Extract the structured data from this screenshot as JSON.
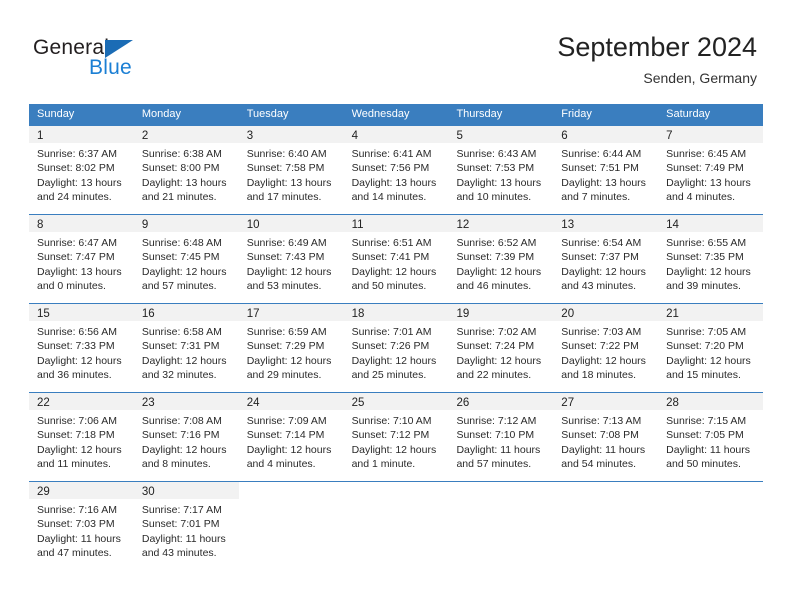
{
  "brand": {
    "name_primary": "General",
    "name_secondary": "Blue",
    "triangle_color": "#1b6cb5",
    "secondary_color": "#1b7fd4"
  },
  "header": {
    "title": "September 2024",
    "subtitle": "Senden, Germany"
  },
  "theme": {
    "header_bg": "#3a7ebf",
    "daynum_band": "#f2f2f2",
    "row_border": "#3a7ebf"
  },
  "weekdays": [
    "Sunday",
    "Monday",
    "Tuesday",
    "Wednesday",
    "Thursday",
    "Friday",
    "Saturday"
  ],
  "labels": {
    "sunrise_prefix": "Sunrise:",
    "sunset_prefix": "Sunset:",
    "daylight_prefix": "Daylight:"
  },
  "weeks": [
    [
      {
        "day": "1",
        "sunrise": "Sunrise: 6:37 AM",
        "sunset": "Sunset: 8:02 PM",
        "daylight_line1": "Daylight: 13 hours",
        "daylight_line2": "and 24 minutes."
      },
      {
        "day": "2",
        "sunrise": "Sunrise: 6:38 AM",
        "sunset": "Sunset: 8:00 PM",
        "daylight_line1": "Daylight: 13 hours",
        "daylight_line2": "and 21 minutes."
      },
      {
        "day": "3",
        "sunrise": "Sunrise: 6:40 AM",
        "sunset": "Sunset: 7:58 PM",
        "daylight_line1": "Daylight: 13 hours",
        "daylight_line2": "and 17 minutes."
      },
      {
        "day": "4",
        "sunrise": "Sunrise: 6:41 AM",
        "sunset": "Sunset: 7:56 PM",
        "daylight_line1": "Daylight: 13 hours",
        "daylight_line2": "and 14 minutes."
      },
      {
        "day": "5",
        "sunrise": "Sunrise: 6:43 AM",
        "sunset": "Sunset: 7:53 PM",
        "daylight_line1": "Daylight: 13 hours",
        "daylight_line2": "and 10 minutes."
      },
      {
        "day": "6",
        "sunrise": "Sunrise: 6:44 AM",
        "sunset": "Sunset: 7:51 PM",
        "daylight_line1": "Daylight: 13 hours",
        "daylight_line2": "and 7 minutes."
      },
      {
        "day": "7",
        "sunrise": "Sunrise: 6:45 AM",
        "sunset": "Sunset: 7:49 PM",
        "daylight_line1": "Daylight: 13 hours",
        "daylight_line2": "and 4 minutes."
      }
    ],
    [
      {
        "day": "8",
        "sunrise": "Sunrise: 6:47 AM",
        "sunset": "Sunset: 7:47 PM",
        "daylight_line1": "Daylight: 13 hours",
        "daylight_line2": "and 0 minutes."
      },
      {
        "day": "9",
        "sunrise": "Sunrise: 6:48 AM",
        "sunset": "Sunset: 7:45 PM",
        "daylight_line1": "Daylight: 12 hours",
        "daylight_line2": "and 57 minutes."
      },
      {
        "day": "10",
        "sunrise": "Sunrise: 6:49 AM",
        "sunset": "Sunset: 7:43 PM",
        "daylight_line1": "Daylight: 12 hours",
        "daylight_line2": "and 53 minutes."
      },
      {
        "day": "11",
        "sunrise": "Sunrise: 6:51 AM",
        "sunset": "Sunset: 7:41 PM",
        "daylight_line1": "Daylight: 12 hours",
        "daylight_line2": "and 50 minutes."
      },
      {
        "day": "12",
        "sunrise": "Sunrise: 6:52 AM",
        "sunset": "Sunset: 7:39 PM",
        "daylight_line1": "Daylight: 12 hours",
        "daylight_line2": "and 46 minutes."
      },
      {
        "day": "13",
        "sunrise": "Sunrise: 6:54 AM",
        "sunset": "Sunset: 7:37 PM",
        "daylight_line1": "Daylight: 12 hours",
        "daylight_line2": "and 43 minutes."
      },
      {
        "day": "14",
        "sunrise": "Sunrise: 6:55 AM",
        "sunset": "Sunset: 7:35 PM",
        "daylight_line1": "Daylight: 12 hours",
        "daylight_line2": "and 39 minutes."
      }
    ],
    [
      {
        "day": "15",
        "sunrise": "Sunrise: 6:56 AM",
        "sunset": "Sunset: 7:33 PM",
        "daylight_line1": "Daylight: 12 hours",
        "daylight_line2": "and 36 minutes."
      },
      {
        "day": "16",
        "sunrise": "Sunrise: 6:58 AM",
        "sunset": "Sunset: 7:31 PM",
        "daylight_line1": "Daylight: 12 hours",
        "daylight_line2": "and 32 minutes."
      },
      {
        "day": "17",
        "sunrise": "Sunrise: 6:59 AM",
        "sunset": "Sunset: 7:29 PM",
        "daylight_line1": "Daylight: 12 hours",
        "daylight_line2": "and 29 minutes."
      },
      {
        "day": "18",
        "sunrise": "Sunrise: 7:01 AM",
        "sunset": "Sunset: 7:26 PM",
        "daylight_line1": "Daylight: 12 hours",
        "daylight_line2": "and 25 minutes."
      },
      {
        "day": "19",
        "sunrise": "Sunrise: 7:02 AM",
        "sunset": "Sunset: 7:24 PM",
        "daylight_line1": "Daylight: 12 hours",
        "daylight_line2": "and 22 minutes."
      },
      {
        "day": "20",
        "sunrise": "Sunrise: 7:03 AM",
        "sunset": "Sunset: 7:22 PM",
        "daylight_line1": "Daylight: 12 hours",
        "daylight_line2": "and 18 minutes."
      },
      {
        "day": "21",
        "sunrise": "Sunrise: 7:05 AM",
        "sunset": "Sunset: 7:20 PM",
        "daylight_line1": "Daylight: 12 hours",
        "daylight_line2": "and 15 minutes."
      }
    ],
    [
      {
        "day": "22",
        "sunrise": "Sunrise: 7:06 AM",
        "sunset": "Sunset: 7:18 PM",
        "daylight_line1": "Daylight: 12 hours",
        "daylight_line2": "and 11 minutes."
      },
      {
        "day": "23",
        "sunrise": "Sunrise: 7:08 AM",
        "sunset": "Sunset: 7:16 PM",
        "daylight_line1": "Daylight: 12 hours",
        "daylight_line2": "and 8 minutes."
      },
      {
        "day": "24",
        "sunrise": "Sunrise: 7:09 AM",
        "sunset": "Sunset: 7:14 PM",
        "daylight_line1": "Daylight: 12 hours",
        "daylight_line2": "and 4 minutes."
      },
      {
        "day": "25",
        "sunrise": "Sunrise: 7:10 AM",
        "sunset": "Sunset: 7:12 PM",
        "daylight_line1": "Daylight: 12 hours",
        "daylight_line2": "and 1 minute."
      },
      {
        "day": "26",
        "sunrise": "Sunrise: 7:12 AM",
        "sunset": "Sunset: 7:10 PM",
        "daylight_line1": "Daylight: 11 hours",
        "daylight_line2": "and 57 minutes."
      },
      {
        "day": "27",
        "sunrise": "Sunrise: 7:13 AM",
        "sunset": "Sunset: 7:08 PM",
        "daylight_line1": "Daylight: 11 hours",
        "daylight_line2": "and 54 minutes."
      },
      {
        "day": "28",
        "sunrise": "Sunrise: 7:15 AM",
        "sunset": "Sunset: 7:05 PM",
        "daylight_line1": "Daylight: 11 hours",
        "daylight_line2": "and 50 minutes."
      }
    ],
    [
      {
        "day": "29",
        "sunrise": "Sunrise: 7:16 AM",
        "sunset": "Sunset: 7:03 PM",
        "daylight_line1": "Daylight: 11 hours",
        "daylight_line2": "and 47 minutes."
      },
      {
        "day": "30",
        "sunrise": "Sunrise: 7:17 AM",
        "sunset": "Sunset: 7:01 PM",
        "daylight_line1": "Daylight: 11 hours",
        "daylight_line2": "and 43 minutes."
      },
      {
        "day": "",
        "sunrise": "",
        "sunset": "",
        "daylight_line1": "",
        "daylight_line2": ""
      },
      {
        "day": "",
        "sunrise": "",
        "sunset": "",
        "daylight_line1": "",
        "daylight_line2": ""
      },
      {
        "day": "",
        "sunrise": "",
        "sunset": "",
        "daylight_line1": "",
        "daylight_line2": ""
      },
      {
        "day": "",
        "sunrise": "",
        "sunset": "",
        "daylight_line1": "",
        "daylight_line2": ""
      },
      {
        "day": "",
        "sunrise": "",
        "sunset": "",
        "daylight_line1": "",
        "daylight_line2": ""
      }
    ]
  ]
}
